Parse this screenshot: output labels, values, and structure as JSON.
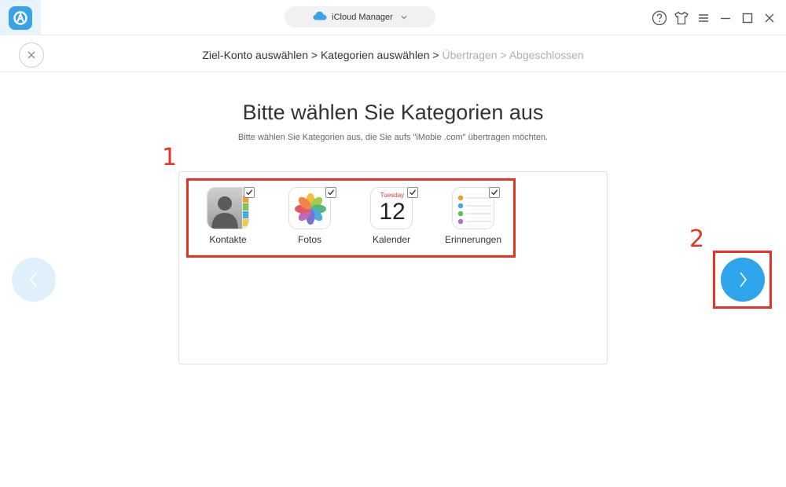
{
  "app": {
    "mode_label": "iCloud Manager",
    "logo_icon": "anytrans-logo-icon"
  },
  "window_controls": {
    "help_icon": "help-icon",
    "skin_icon": "tshirt-icon",
    "menu_icon": "menu-icon",
    "minimize_icon": "minimize-icon",
    "maximize_icon": "maximize-icon",
    "close_icon": "close-icon"
  },
  "breadcrumb": {
    "step1": "Ziel-Konto auswählen",
    "sep1": " > ",
    "step2": "Kategorien auswählen",
    "sep2": " > ",
    "step3": "Übertragen",
    "sep3": " > ",
    "step4": "Abgeschlossen"
  },
  "main": {
    "title": "Bitte wählen Sie Kategorien aus",
    "subtitle": "Bitte wählen Sie Kategorien aus, die Sie aufs \"iMobie .com\" übertragen möchten."
  },
  "categories": [
    {
      "label": "Kontakte",
      "icon": "contacts-icon",
      "checked": true
    },
    {
      "label": "Fotos",
      "icon": "photos-icon",
      "checked": true
    },
    {
      "label": "Kalender",
      "icon": "calendar-icon",
      "checked": true,
      "calendar_day": "Tuesday",
      "calendar_date": "12"
    },
    {
      "label": "Erinnerungen",
      "icon": "reminders-icon",
      "checked": true
    }
  ],
  "annotations": {
    "step_one": "1",
    "step_two": "2"
  },
  "colors": {
    "accent": "#2ea4ec",
    "highlight": "#e53522",
    "prev_button": "#dff0fb"
  }
}
